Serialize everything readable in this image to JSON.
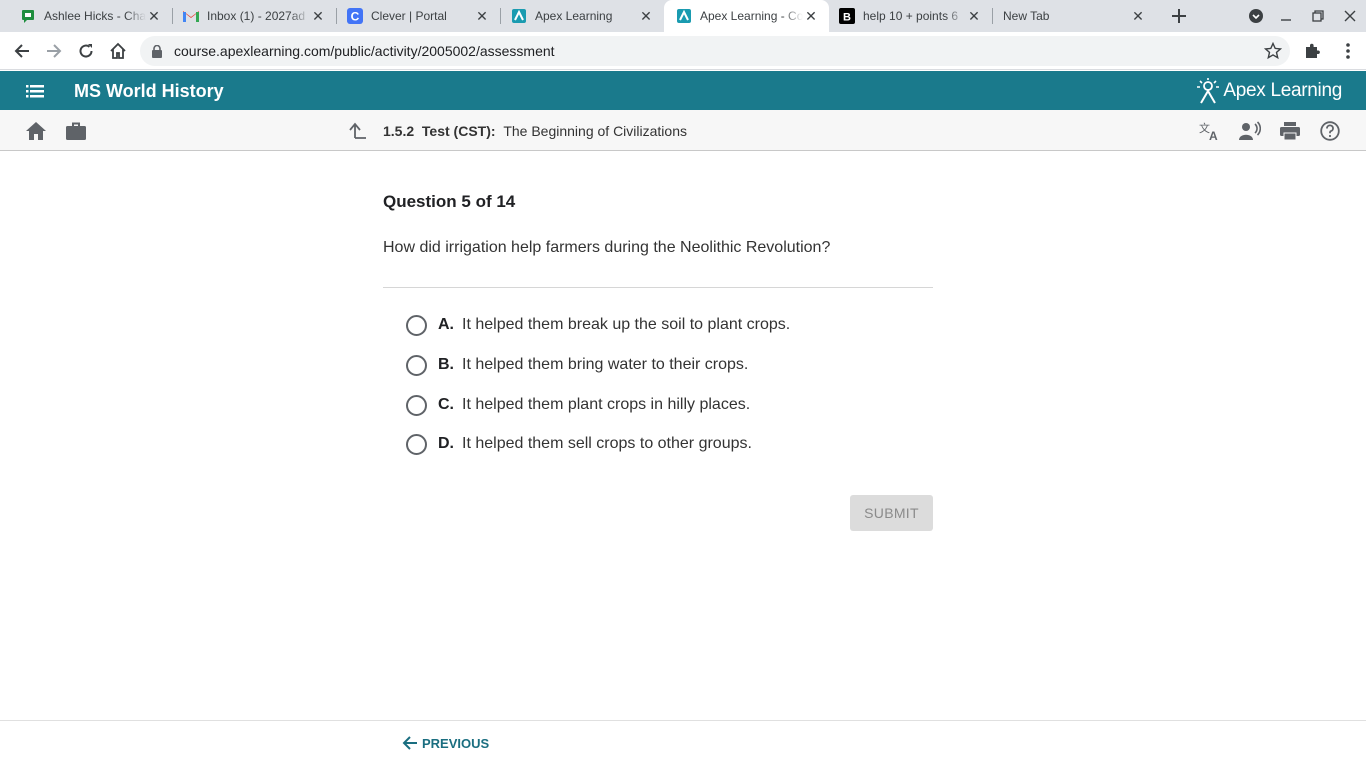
{
  "browser": {
    "tabs": [
      {
        "title": "Ashlee Hicks - Cha",
        "favicon": "google-chat-icon"
      },
      {
        "title": "Inbox (1) - 2027ad",
        "favicon": "gmail-icon"
      },
      {
        "title": "Clever | Portal",
        "favicon": "clever-icon"
      },
      {
        "title": "Apex Learning",
        "favicon": "apex-icon"
      },
      {
        "title": "Apex Learning - Co",
        "favicon": "apex-icon"
      },
      {
        "title": "help 10 + points 6",
        "favicon": "brainly-icon"
      },
      {
        "title": "New Tab",
        "favicon": ""
      }
    ],
    "active_tab": 4,
    "url": "course.apexlearning.com/public/activity/2005002/assessment"
  },
  "header": {
    "course_title": "MS World History",
    "logo_text": "Apex Learning",
    "brand_color": "#1a7a8c"
  },
  "activity": {
    "number": "1.5.2",
    "type": "Test (CST):",
    "title": "The Beginning of Civilizations"
  },
  "question": {
    "counter": "Question 5 of 14",
    "prompt": "How did irrigation help farmers during the Neolithic Revolution?",
    "choices": [
      {
        "letter": "A.",
        "text": "It helped them break up the soil to plant crops."
      },
      {
        "letter": "B.",
        "text": "It helped them bring water to their crops."
      },
      {
        "letter": "C.",
        "text": "It helped them plant crops in hilly places."
      },
      {
        "letter": "D.",
        "text": "It helped them sell crops to other groups."
      }
    ],
    "submit_label": "SUBMIT"
  },
  "footer": {
    "previous_label": "PREVIOUS"
  }
}
